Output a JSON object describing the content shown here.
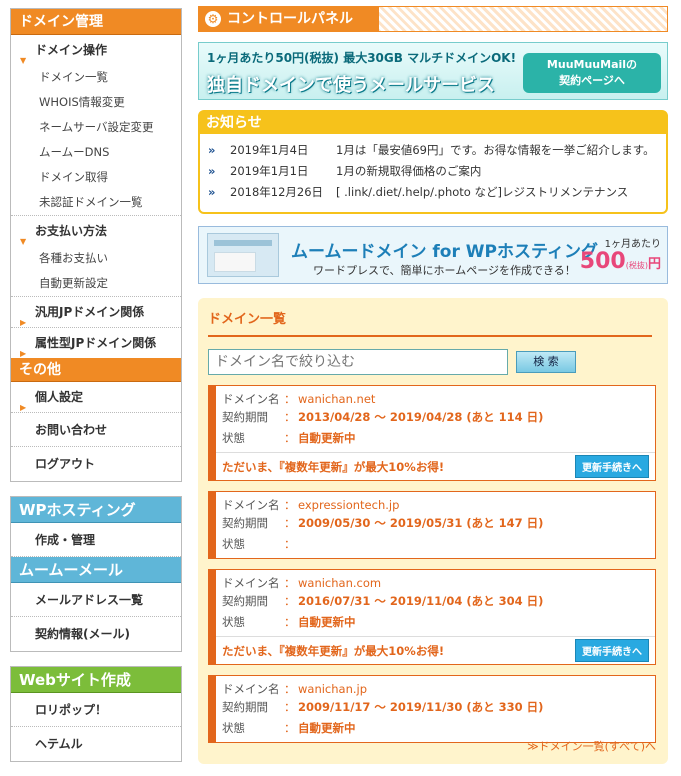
{
  "sidebar": {
    "domain_head": "ドメイン管理",
    "domain_ops": {
      "title": "ドメイン操作",
      "items": [
        "ドメイン一覧",
        "WHOIS情報変更",
        "ネームサーバ設定変更",
        "ムームーDNS",
        "ドメイン取得",
        "未認証ドメイン一覧"
      ]
    },
    "payment": {
      "title": "お支払い方法",
      "items": [
        "各種お支払い",
        "自動更新設定"
      ]
    },
    "jp_general": "汎用JPドメイン関係",
    "jp_attr": "属性型JPドメイン関係",
    "other_head": "その他",
    "personal": "個人設定",
    "contact": "お問い合わせ",
    "logout": "ログアウト",
    "wp_head": "WPホスティング",
    "wp_create": "作成・管理",
    "mail_head": "ムームーメール",
    "mail_list": "メールアドレス一覧",
    "mail_contract": "契約情報(メール)",
    "web_head": "Webサイト作成",
    "lolipop": "ロリポップ！",
    "hetemuru": "ヘテムル"
  },
  "main": {
    "cp_title": "コントロールパネル",
    "banner1": {
      "top": "1ヶ月あたり50円(税抜) 最大30GB マルチドメインOK!",
      "main": "独自ドメインで使うメールサービス",
      "btn1": "MuuMuuMailの",
      "btn2": "契約ページへ"
    },
    "news": {
      "title": "お知らせ",
      "items": [
        {
          "date": "2019年1月4日",
          "text": "1月は「最安値69円」です。お得な情報を一挙ご紹介します。"
        },
        {
          "date": "2019年1月1日",
          "text": "1月の新規取得価格のご案内"
        },
        {
          "date": "2018年12月26日",
          "text": "[ .link/.diet/.help/.photo など]レジストリメンテナンス"
        }
      ]
    },
    "banner2": {
      "title": "ムームードメイン for WPホスティング",
      "sub": "ワードプレスで、簡単にホームページを作成できる！",
      "per": "1ヶ月あたり",
      "price": "500",
      "unit": "円",
      "tax": "(税抜)"
    },
    "domain_list": {
      "title": "ドメイン一覧",
      "search_placeholder": "ドメイン名で絞り込む",
      "search_btn": "検 索",
      "label_domain": "ドメイン名",
      "label_period": "契約期間",
      "label_status": "状態",
      "sep": "：",
      "promo_text": "ただいま、『複数年更新』が最大10%お得!",
      "promo_btn": "更新手続きへ",
      "all_link": "≫ドメイン一覧(すべて)へ",
      "cards": [
        {
          "domain": "wanichan.net",
          "period": "2013/04/28 ～ 2019/04/28 (あと 114 日)",
          "status": "自動更新中",
          "promo": true
        },
        {
          "domain": "expressiontech.jp",
          "period": "2009/05/30 ～ 2019/05/31 (あと 147 日)",
          "status": "",
          "promo": false
        },
        {
          "domain": "wanichan.com",
          "period": "2016/07/31 ～ 2019/11/04 (あと 304 日)",
          "status": "自動更新中",
          "promo": true
        },
        {
          "domain": "wanichan.jp",
          "period": "2009/11/17 ～ 2019/11/30 (あと 330 日)",
          "status": "自動更新中",
          "promo": false
        }
      ]
    }
  }
}
